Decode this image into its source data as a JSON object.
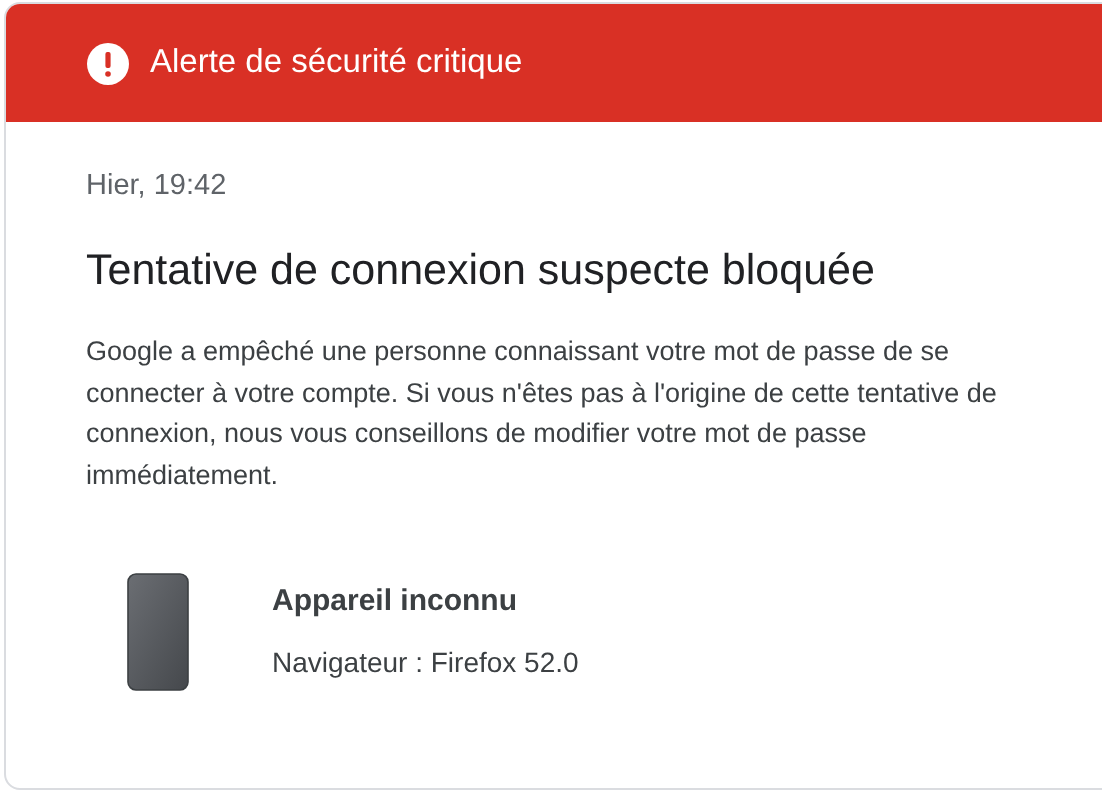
{
  "header": {
    "title": "Alerte de sécurité critique"
  },
  "timestamp": "Hier, 19:42",
  "heading": "Tentative de connexion suspecte bloquée",
  "message": "Google a empêché une personne connaissant votre mot de passe de se connecter à votre compte. Si vous n'êtes pas à l'origine de cette tentative de connexion, nous vous conseillons de modifier votre mot de passe immédiatement.",
  "device": {
    "name": "Appareil inconnu",
    "browser": "Navigateur : Firefox 52.0"
  }
}
